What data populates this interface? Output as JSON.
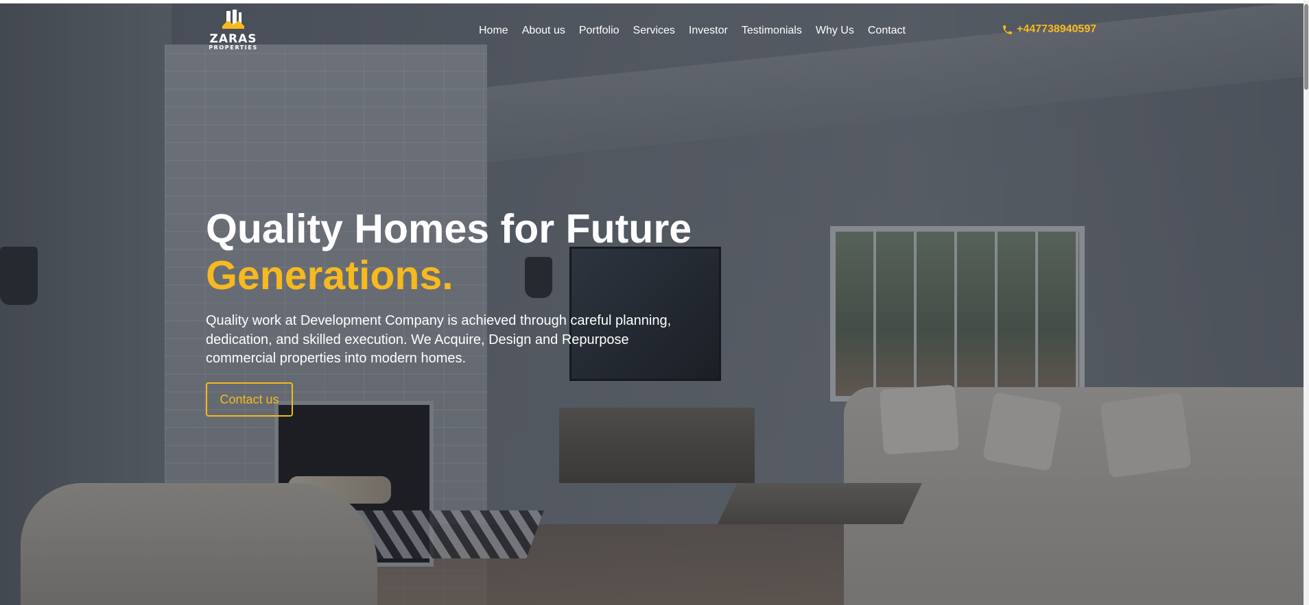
{
  "brand": {
    "name": "ZARAS",
    "subtitle": "PROPERTIES",
    "logo_icon": "building-crown-logo",
    "accent_color": "#f7b91f"
  },
  "nav": {
    "items": [
      {
        "label": "Home"
      },
      {
        "label": "About us"
      },
      {
        "label": "Portfolio"
      },
      {
        "label": "Services"
      },
      {
        "label": "Investor"
      },
      {
        "label": "Testimonials"
      },
      {
        "label": "Why Us"
      },
      {
        "label": "Contact"
      }
    ],
    "phone": {
      "icon": "phone-icon",
      "number": "+447738940597"
    }
  },
  "hero": {
    "title_line1": "Quality Homes for Future",
    "title_line2": "Generations.",
    "description": "Quality work at Development Company is achieved through careful planning, dedication, and skilled execution. We Acquire, Design and Repurpose commercial properties into modern homes.",
    "cta_label": "Contact us",
    "background_image": "living-room-photo"
  }
}
